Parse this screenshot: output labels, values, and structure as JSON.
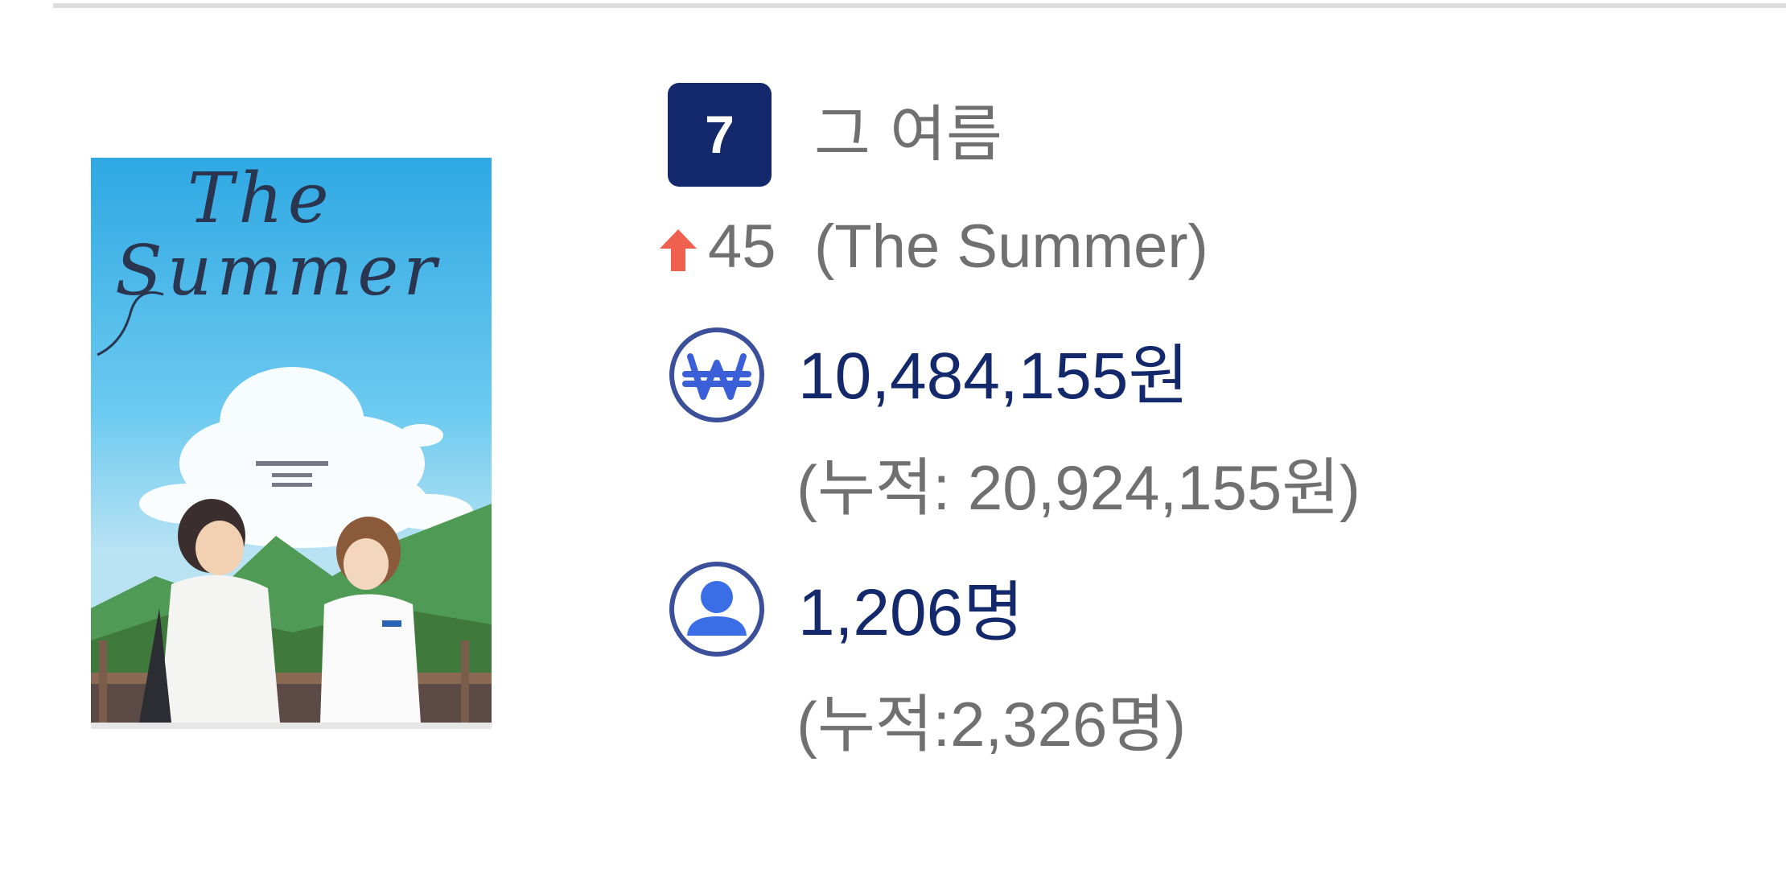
{
  "movie": {
    "rank": "7",
    "title_ko": "그 여름",
    "rank_change": {
      "direction": "up",
      "value": "45",
      "arrow_icon": "arrow-up-icon",
      "arrow_color": "#f0604f"
    },
    "title_en": "(The Summer)",
    "poster": {
      "title_lettering": [
        "The",
        "Summer"
      ]
    },
    "sales": {
      "icon": "won-icon",
      "value": "10,484,155원",
      "cumulative": "(누적: 20,924,155원)"
    },
    "audience": {
      "icon": "person-icon",
      "value": "1,206명",
      "cumulative": "(누적:2,326명)"
    }
  },
  "colors": {
    "navy": "#13296b",
    "icon_blue": "#3b5fd6",
    "muted_text": "#707070",
    "divider": "#dddddd"
  }
}
